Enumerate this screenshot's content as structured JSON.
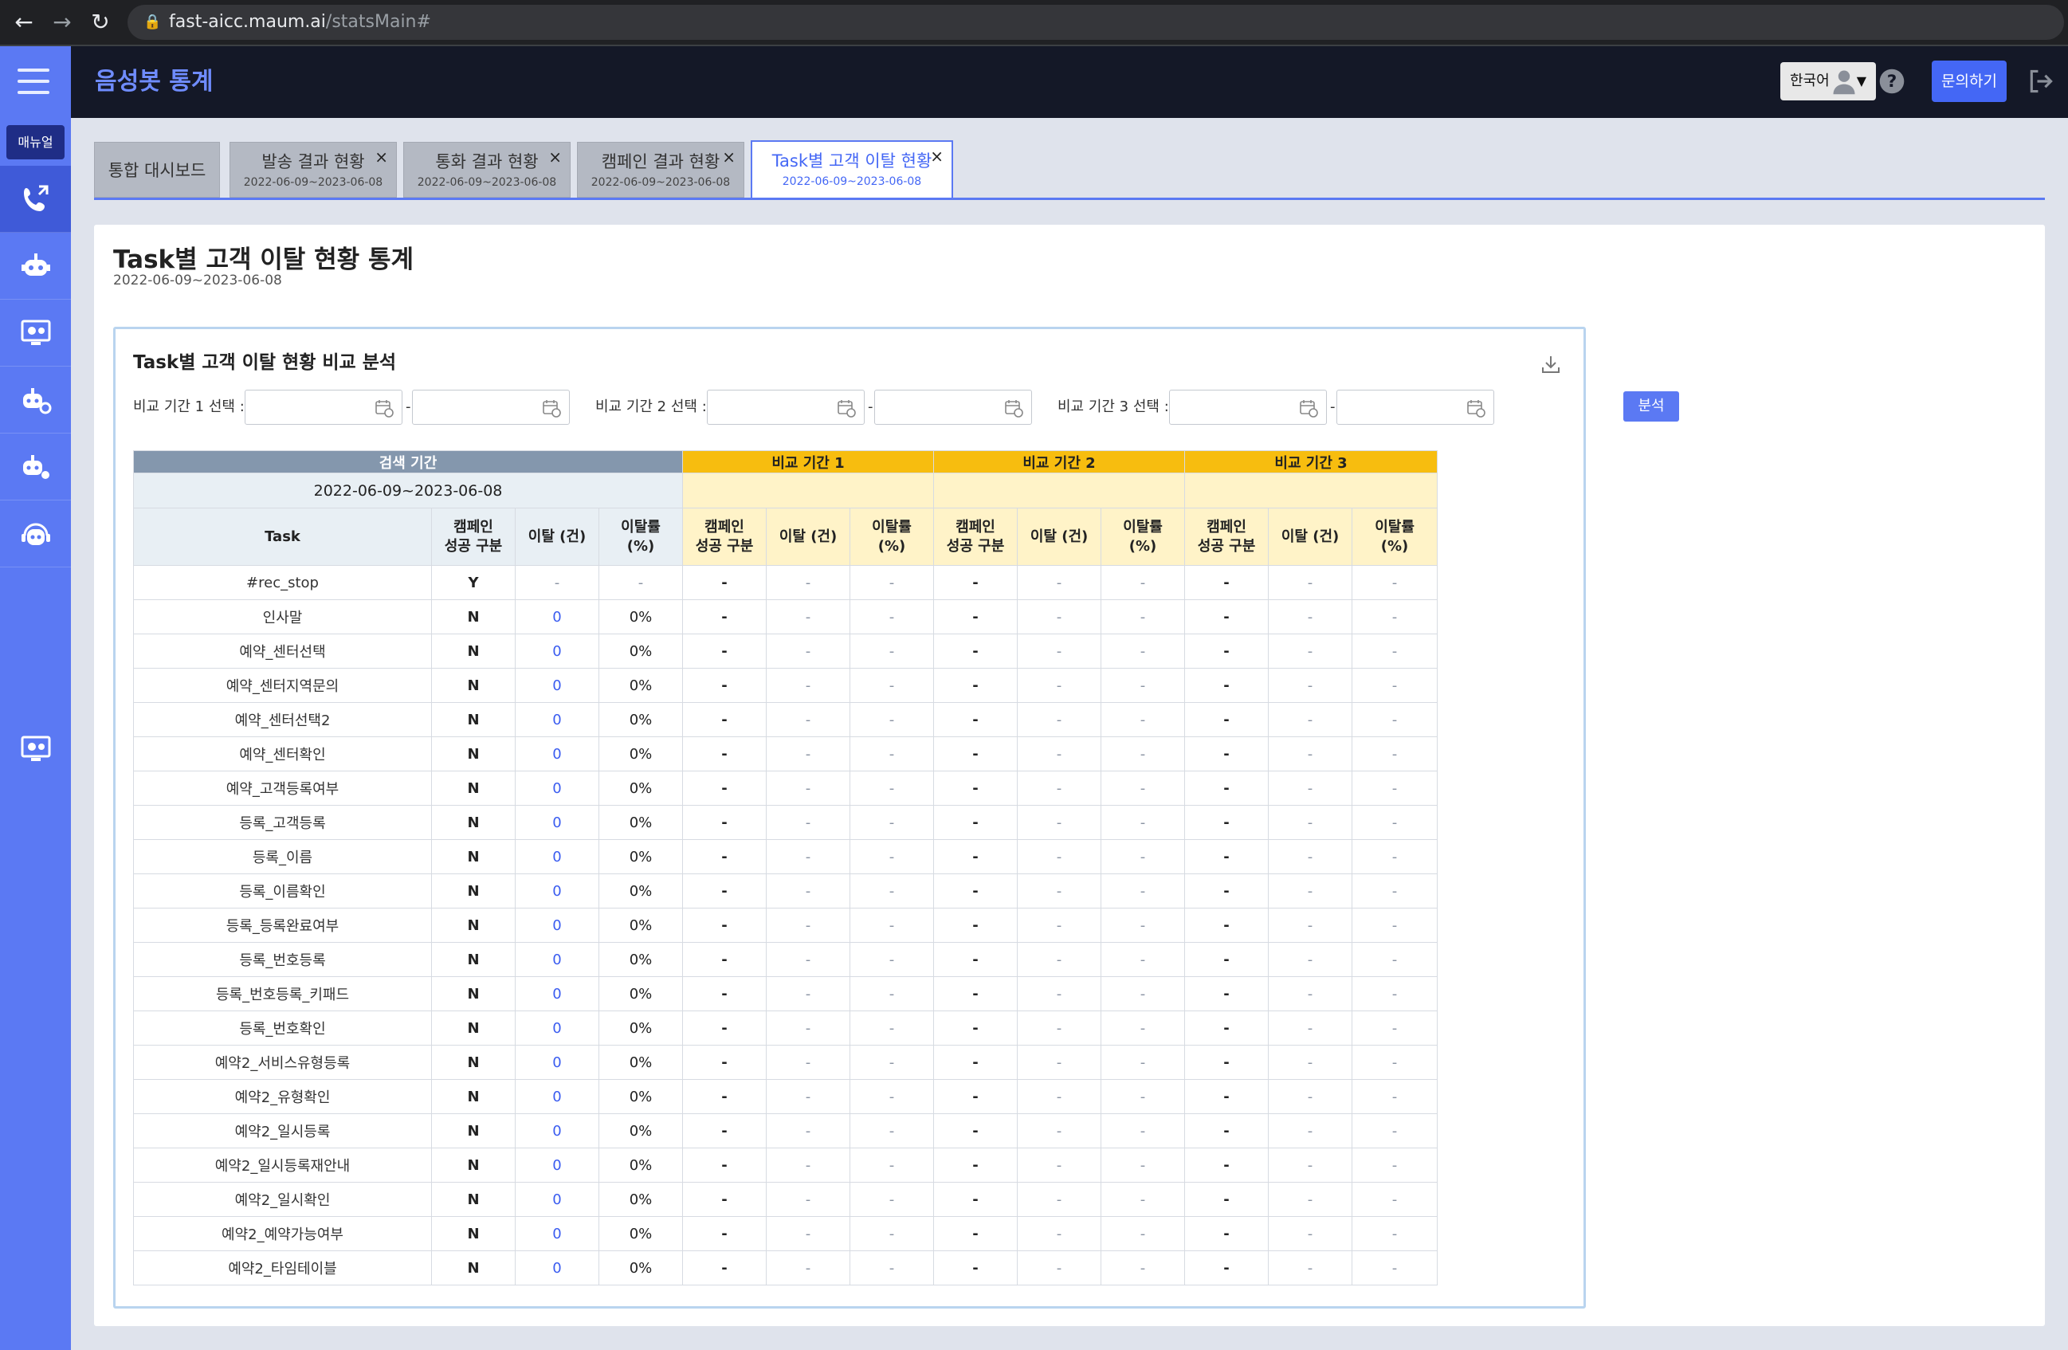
{
  "browser": {
    "url_host": "fast-aicc.maum.ai",
    "url_path": "/statsMain#"
  },
  "header": {
    "title": "음성봇 통계",
    "language": "한국어",
    "inquiry_label": "문의하기"
  },
  "sidebar": {
    "manual_label": "매뉴얼",
    "items": [
      "call-forward-icon",
      "robot-icon",
      "monitor-settings-icon",
      "robot-settings-icon",
      "robot-gear-icon",
      "robot-headset-icon",
      "monitor-settings-icon"
    ]
  },
  "tabs": [
    {
      "label": "통합 대시보드",
      "date": "",
      "closable": false,
      "active": false
    },
    {
      "label": "발송 결과 현황",
      "date": "2022-06-09~2023-06-08",
      "closable": true,
      "active": false
    },
    {
      "label": "통화 결과 현황",
      "date": "2022-06-09~2023-06-08",
      "closable": true,
      "active": false
    },
    {
      "label": "캠페인 결과 현황",
      "date": "2022-06-09~2023-06-08",
      "closable": true,
      "active": false
    },
    {
      "label": "Task별 고객 이탈 현황",
      "date": "2022-06-09~2023-06-08",
      "closable": true,
      "active": true
    }
  ],
  "page": {
    "title": "Task별 고객 이탈 현황 통계",
    "subtitle": "2022-06-09~2023-06-08"
  },
  "analysis": {
    "title": "Task별 고객 이탈 현황 비교 분석",
    "period1_label": "비교 기간 1 선택 :",
    "period2_label": "비교 기간 2 선택 :",
    "period3_label": "비교 기간 3 선택 :",
    "range_sep": "-",
    "analyze_label": "분석"
  },
  "table": {
    "group_search": "검색 기간",
    "group_cmp1": "비교 기간 1",
    "group_cmp2": "비교 기간 2",
    "group_cmp3": "비교 기간 3",
    "search_range": "2022-06-09~2023-06-08",
    "col_task": "Task",
    "col_campaign_line1": "캠페인",
    "col_campaign_line2": "성공 구분",
    "col_leave": "이탈 (건)",
    "col_rate_line1": "이탈률",
    "col_rate_line2": "(%)",
    "rows": [
      {
        "task": "#rec_stop",
        "yn": "Y",
        "leave": "-",
        "rate": "-"
      },
      {
        "task": "인사말",
        "yn": "N",
        "leave": "0",
        "rate": "0%"
      },
      {
        "task": "예약_센터선택",
        "yn": "N",
        "leave": "0",
        "rate": "0%"
      },
      {
        "task": "예약_센터지역문의",
        "yn": "N",
        "leave": "0",
        "rate": "0%"
      },
      {
        "task": "예약_센터선택2",
        "yn": "N",
        "leave": "0",
        "rate": "0%"
      },
      {
        "task": "예약_센터확인",
        "yn": "N",
        "leave": "0",
        "rate": "0%"
      },
      {
        "task": "예약_고객등록여부",
        "yn": "N",
        "leave": "0",
        "rate": "0%"
      },
      {
        "task": "등록_고객등록",
        "yn": "N",
        "leave": "0",
        "rate": "0%"
      },
      {
        "task": "등록_이름",
        "yn": "N",
        "leave": "0",
        "rate": "0%"
      },
      {
        "task": "등록_이름확인",
        "yn": "N",
        "leave": "0",
        "rate": "0%"
      },
      {
        "task": "등록_등록완료여부",
        "yn": "N",
        "leave": "0",
        "rate": "0%"
      },
      {
        "task": "등록_번호등록",
        "yn": "N",
        "leave": "0",
        "rate": "0%"
      },
      {
        "task": "등록_번호등록_키패드",
        "yn": "N",
        "leave": "0",
        "rate": "0%"
      },
      {
        "task": "등록_번호확인",
        "yn": "N",
        "leave": "0",
        "rate": "0%"
      },
      {
        "task": "예약2_서비스유형등록",
        "yn": "N",
        "leave": "0",
        "rate": "0%"
      },
      {
        "task": "예약2_유형확인",
        "yn": "N",
        "leave": "0",
        "rate": "0%"
      },
      {
        "task": "예약2_일시등록",
        "yn": "N",
        "leave": "0",
        "rate": "0%"
      },
      {
        "task": "예약2_일시등록재안내",
        "yn": "N",
        "leave": "0",
        "rate": "0%"
      },
      {
        "task": "예약2_일시확인",
        "yn": "N",
        "leave": "0",
        "rate": "0%"
      },
      {
        "task": "예약2_예약가능여부",
        "yn": "N",
        "leave": "0",
        "rate": "0%"
      },
      {
        "task": "예약2_타임테이블",
        "yn": "N",
        "leave": "0",
        "rate": "0%"
      }
    ],
    "empty_value": "-"
  },
  "colors": {
    "sidebar": "#5b79f3",
    "header_bg": "#141827",
    "header_title": "#6f8cff",
    "accent": "#4467f5",
    "search_header": "#8497ad",
    "compare_header": "#f7bd0f",
    "compare_cell": "#fff3c8"
  }
}
